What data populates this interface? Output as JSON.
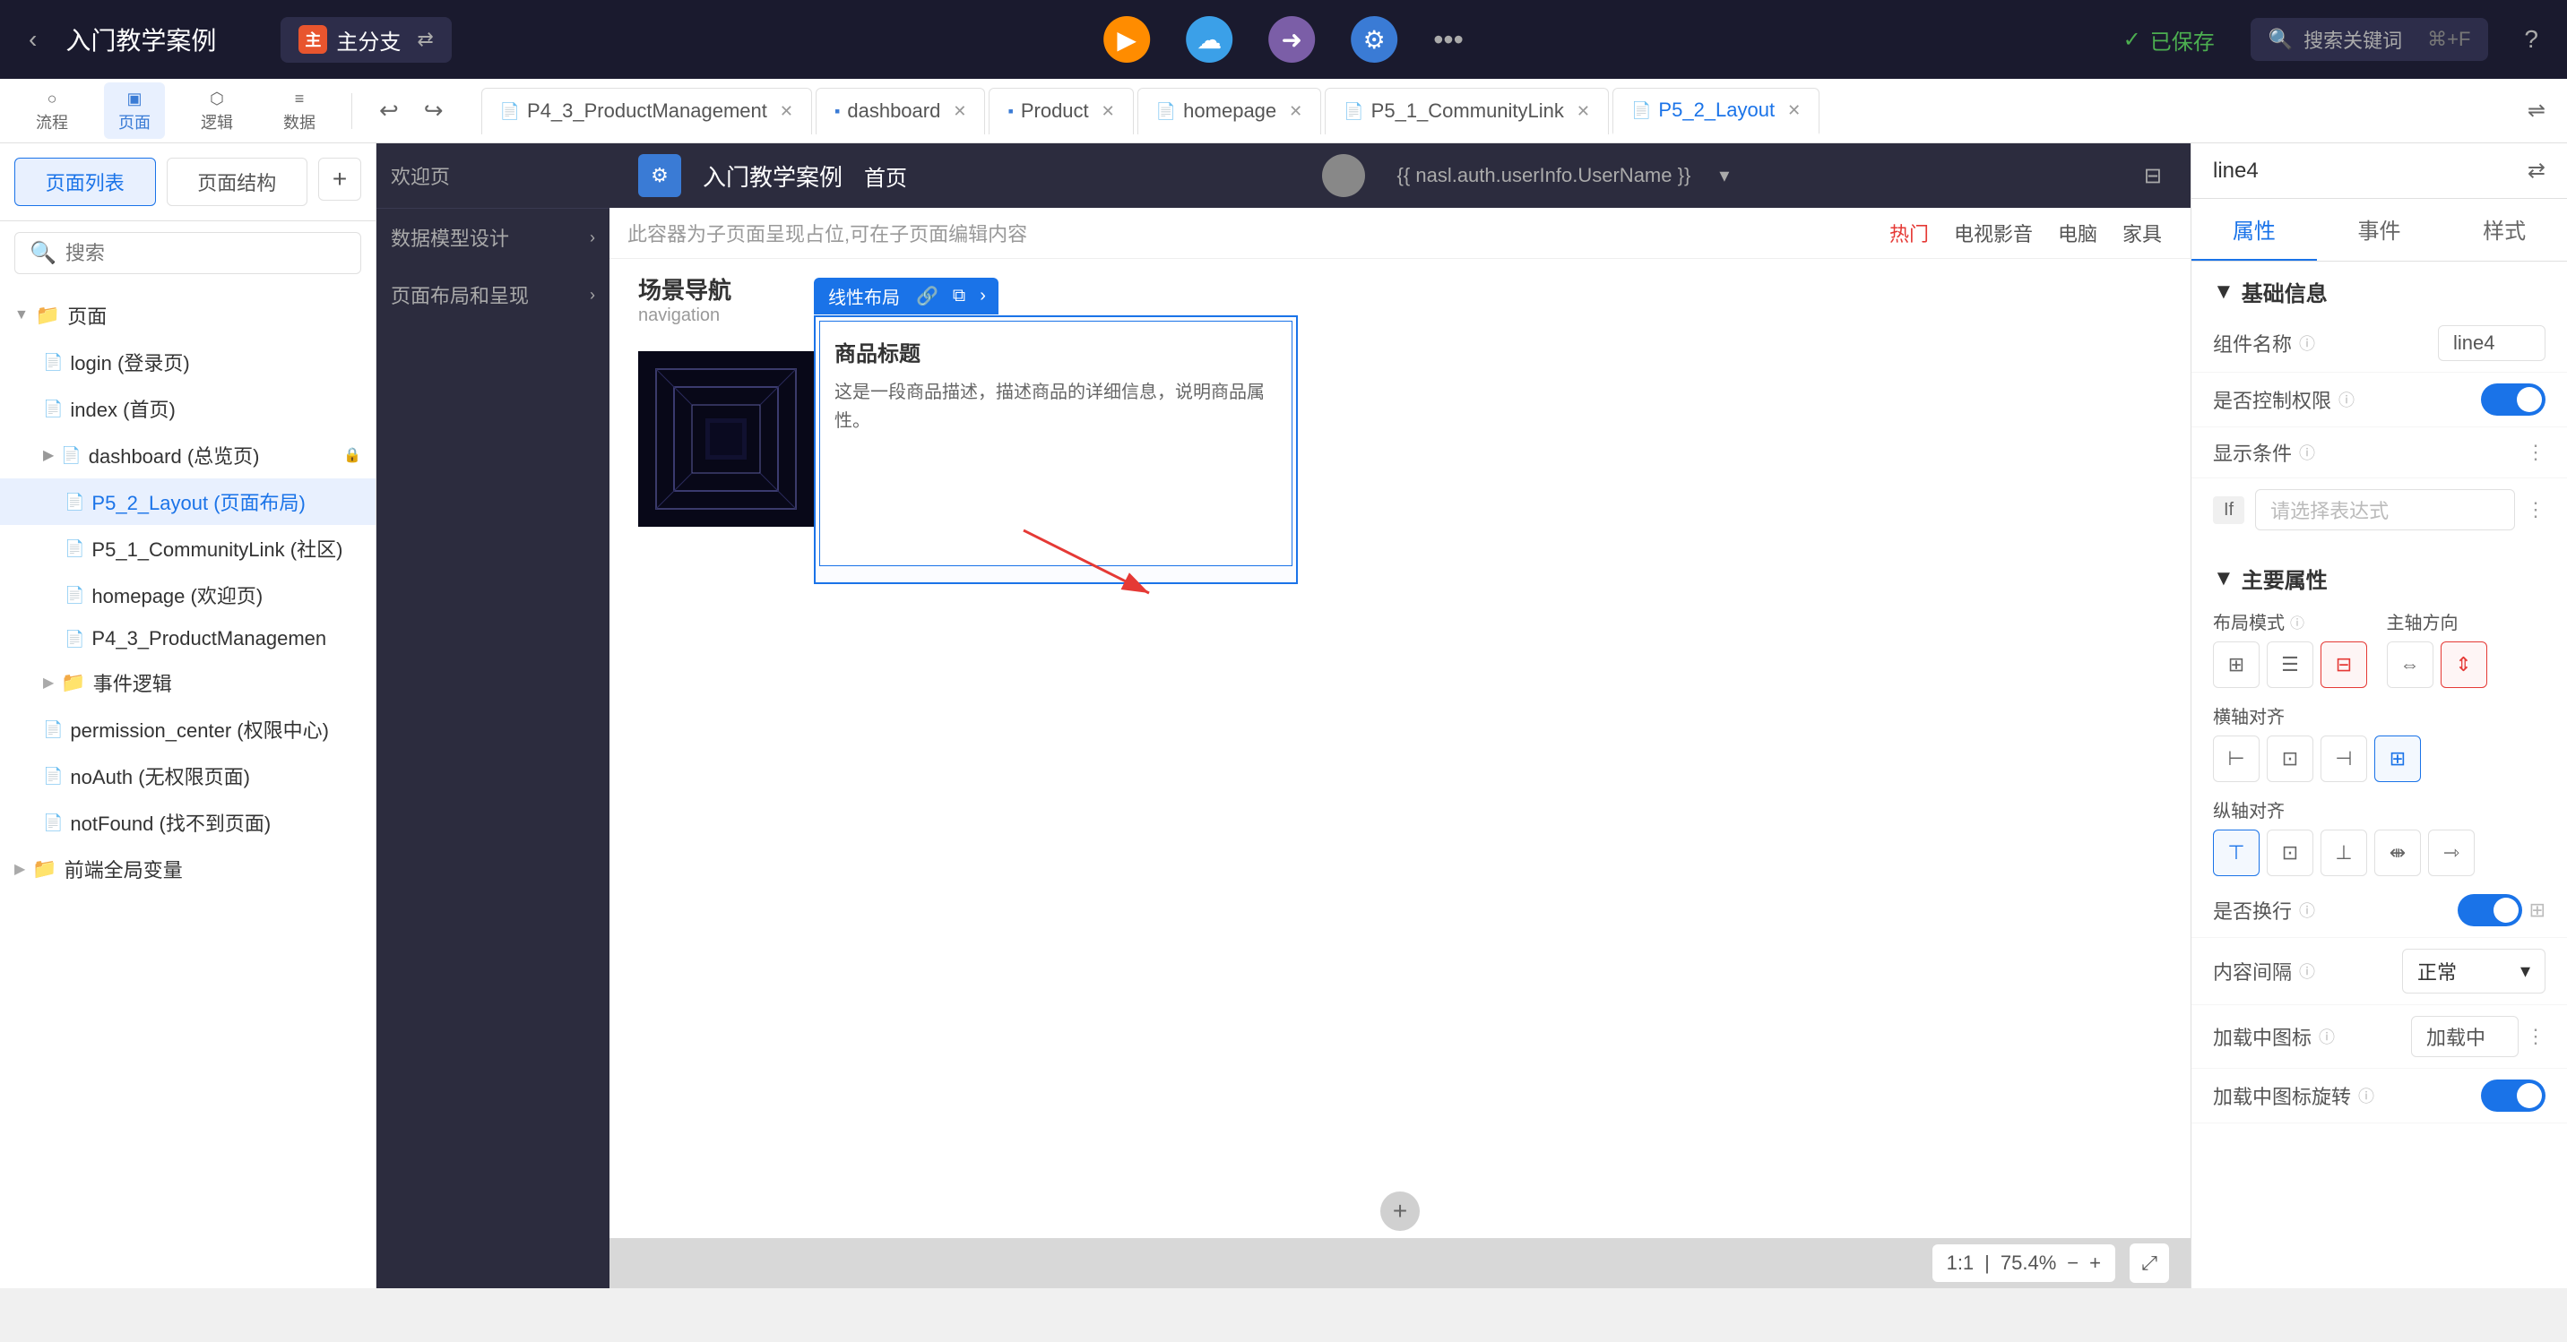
{
  "topBar": {
    "backLabel": "‹",
    "projectTitle": "入门教学案例",
    "branchLabel": "主分支",
    "syncIcon": "⇄",
    "icons": [
      {
        "name": "play-icon",
        "symbol": "▶",
        "class": "play"
      },
      {
        "name": "cloud-icon",
        "symbol": "☁",
        "class": "cloud"
      },
      {
        "name": "share-icon",
        "symbol": "➜",
        "class": "circle"
      },
      {
        "name": "settings-icon",
        "symbol": "⚙",
        "class": "gear"
      }
    ],
    "moreLabel": "•••",
    "savedLabel": "✓ 已保存",
    "searchPlaceholder": "搜索关键词",
    "searchShortcut": "⌘+F",
    "helpLabel": "?"
  },
  "toolbar": {
    "tools": [
      {
        "label": "流程",
        "icon": "○",
        "active": false
      },
      {
        "label": "页面",
        "icon": "▣",
        "active": true
      },
      {
        "label": "逻辑",
        "icon": "⬡",
        "active": false
      },
      {
        "label": "数据",
        "icon": "≡",
        "active": false
      }
    ],
    "undoLabel": "↩",
    "redoLabel": "↪"
  },
  "tabs": [
    {
      "label": "P4_3_ProductManagement",
      "icon": "📄",
      "active": false
    },
    {
      "label": "dashboard",
      "icon": "▪",
      "active": false
    },
    {
      "label": "Product",
      "icon": "▪",
      "active": false
    },
    {
      "label": "homepage",
      "icon": "📄",
      "active": false
    },
    {
      "label": "P5_1_CommunityLink",
      "icon": "📄",
      "active": false
    },
    {
      "label": "P5_2_Layout",
      "icon": "📄",
      "active": true
    }
  ],
  "sidebar": {
    "tabPage": "页面列表",
    "tabStruct": "页面结构",
    "addBtn": "+",
    "searchPlaceholder": "搜索",
    "tree": [
      {
        "label": "页面",
        "type": "folder",
        "indent": 0,
        "expanded": true,
        "color": "yellow"
      },
      {
        "label": "login (登录页)",
        "type": "file",
        "indent": 1
      },
      {
        "label": "index (首页)",
        "type": "file",
        "indent": 1
      },
      {
        "label": "dashboard (总览页)",
        "type": "file",
        "indent": 1,
        "hasLock": true
      },
      {
        "label": "P5_2_Layout (页面布局)",
        "type": "file",
        "indent": 2,
        "active": true
      },
      {
        "label": "P5_1_CommunityLink (社区)",
        "type": "file",
        "indent": 2
      },
      {
        "label": "homepage (欢迎页)",
        "type": "file",
        "indent": 2
      },
      {
        "label": "P4_3_ProductManagemen",
        "type": "file",
        "indent": 2
      },
      {
        "label": "事件逻辑",
        "type": "folder",
        "indent": 1,
        "color": "yellow"
      },
      {
        "label": "permission_center (权限中心)",
        "type": "file",
        "indent": 1
      },
      {
        "label": "noAuth (无权限页面)",
        "type": "file",
        "indent": 1
      },
      {
        "label": "notFound (找不到页面)",
        "type": "file",
        "indent": 1
      },
      {
        "label": "前端全局变量",
        "type": "folder",
        "indent": 0,
        "color": "yellow"
      }
    ]
  },
  "canvas": {
    "appName": "入门教学案例",
    "navItem": "首页",
    "userTemplate": "{{ nasl.auth.userInfo.UserName }}",
    "placeholderMsg": "此容器为子页面呈现占位,可在子页面编辑内容",
    "welcomeLabel": "欢迎页",
    "dataModelLabel": "数据模型设计",
    "layoutLabel": "页面布局和呈现",
    "sceneNavLabel": "场景导航",
    "sceneNavSub": "navigation",
    "productTitleLabel": "商品标题",
    "productDescLabel": "这是一段商品描述，描述商品的详细信息，说明商品属性。",
    "linearLayoutLabel": "线性布局",
    "navItems": [
      "热门",
      "电视影音",
      "电脑",
      "家具"
    ],
    "zoomRatio": "1:1",
    "zoomPercent": "75.4%",
    "addRowBtn": "+",
    "expandBtn": "⤢"
  },
  "rightPanel": {
    "componentName": "line4",
    "tabs": [
      "属性",
      "事件",
      "样式"
    ],
    "sections": {
      "basicInfo": {
        "label": "基础信息",
        "componentNameLabel": "组件名称",
        "componentNameValue": "line4",
        "permissionLabel": "是否控制权限",
        "displayCondLabel": "显示条件",
        "ifLabel": "If",
        "condPlaceholder": "请选择表达式"
      },
      "mainProps": {
        "label": "主要属性",
        "layoutModeLabel": "布局模式",
        "mainAxisLabel": "主轴方向",
        "crossAlignLabel": "横轴对齐",
        "mainAlignLabel": "纵轴对齐",
        "isWrapLabel": "是否换行",
        "gapLabel": "内容间隔",
        "gapValue": "正常",
        "loadingIconLabel": "加载中图标",
        "loadingValue": "加载中",
        "loadingRotateLabel": "加载中图标旋转"
      }
    }
  }
}
